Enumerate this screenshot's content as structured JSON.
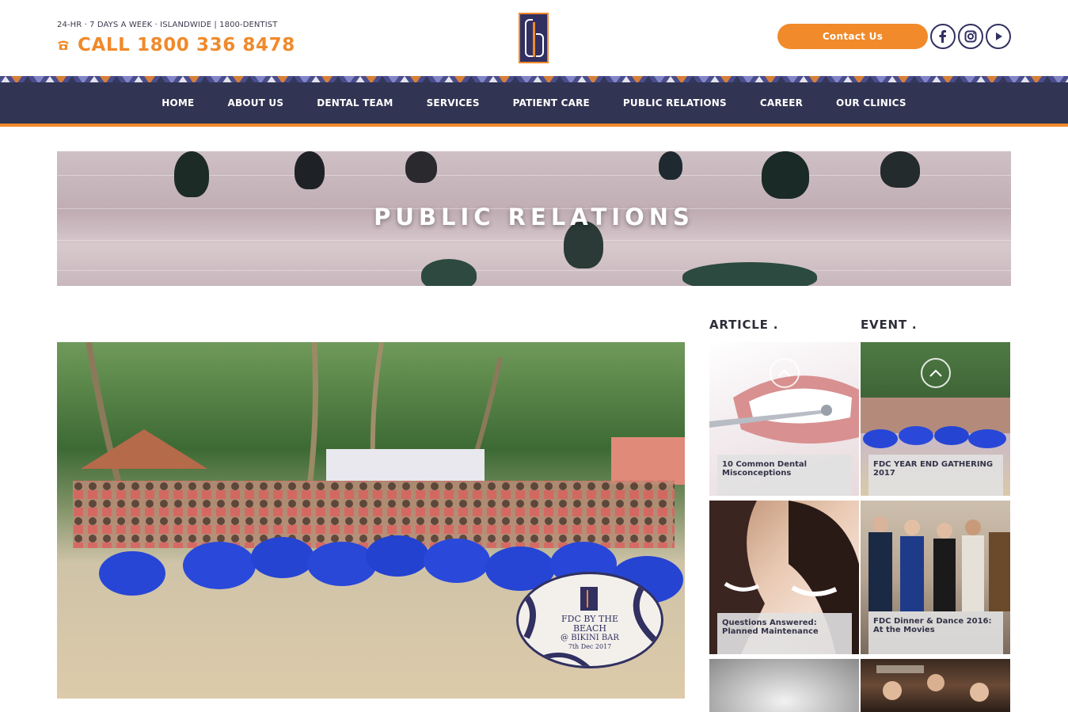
{
  "header": {
    "tagline": "24-HR · 7 DAYS A WEEK · ISLANDWIDE | 1800-DENTIST",
    "phone": "CALL 1800 336 8478",
    "contact_label": "Contact Us",
    "social": [
      "facebook-icon",
      "instagram-icon",
      "youtube-play-icon"
    ]
  },
  "nav": {
    "items": [
      "HOME",
      "ABOUT US",
      "DENTAL TEAM",
      "SERVICES",
      "PATIENT CARE",
      "PUBLIC RELATIONS",
      "CAREER",
      "OUR CLINICS"
    ]
  },
  "hero": {
    "title": "PUBLIC RELATIONS"
  },
  "main_photo": {
    "badge_line1": "FDC BY THE",
    "badge_line2": "BEACH",
    "badge_line3": "@ BIKINI BAR",
    "badge_line4": "7th Dec 2017"
  },
  "sidebar": {
    "article_title": "ARTICLE .",
    "event_title": "EVENT .",
    "articles": [
      {
        "caption": "10 Common Dental Misconceptions"
      },
      {
        "caption": "Questions Answered: Planned Maintenance"
      }
    ],
    "events": [
      {
        "caption": "FDC YEAR END GATHERING 2017"
      },
      {
        "caption": "FDC Dinner & Dance 2016: At the Movies"
      }
    ]
  },
  "colors": {
    "brand_navy": "#313452",
    "brand_orange": "#f08a2b"
  }
}
